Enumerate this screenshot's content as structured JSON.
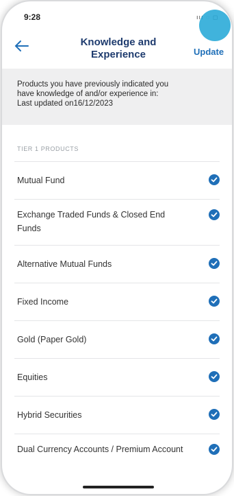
{
  "status_bar": {
    "time": "9:28",
    "signal": "ııı ◌ ◻"
  },
  "nav": {
    "title_line1": "Knowledge and",
    "title_line2": "Experience",
    "update_label": "Update"
  },
  "info": {
    "line1": "Products you have previously indicated you",
    "line2": "have knowledge of and/or experience in:",
    "line3": "Last updated on16/12/2023"
  },
  "section": {
    "header": "TIER 1 PRODUCTS"
  },
  "products": [
    {
      "label": "Mutual Fund",
      "checked": true
    },
    {
      "label": "Exchange Traded Funds & Closed End Funds",
      "checked": true
    },
    {
      "label": "Alternative Mutual Funds",
      "checked": true
    },
    {
      "label": "Fixed Income",
      "checked": true
    },
    {
      "label": "Gold (Paper Gold)",
      "checked": true
    },
    {
      "label": "Equities",
      "checked": true
    },
    {
      "label": "Hybrid Securities",
      "checked": true
    },
    {
      "label": "Dual Currency Accounts / Premium Account",
      "checked": true
    }
  ],
  "colors": {
    "accent": "#1f6fb8",
    "title": "#1e3b6e",
    "info_bg": "#efeff0"
  }
}
